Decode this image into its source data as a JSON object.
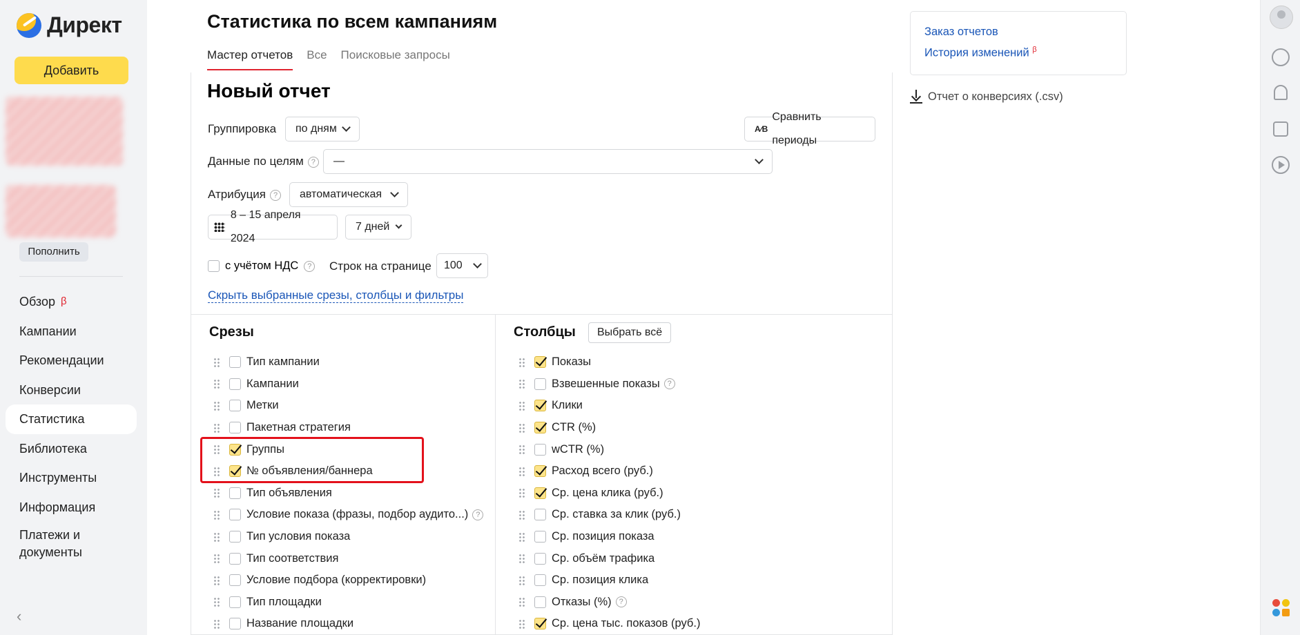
{
  "brand": {
    "name": "Директ"
  },
  "sidebar": {
    "add_label": "Добавить",
    "topup_label": "Пополнить",
    "nav": [
      {
        "label": "Обзор",
        "badge": "β"
      },
      {
        "label": "Кампании"
      },
      {
        "label": "Рекомендации"
      },
      {
        "label": "Конверсии"
      },
      {
        "label": "Статистика",
        "active": true
      },
      {
        "label": "Библиотека"
      },
      {
        "label": "Инструменты"
      },
      {
        "label": "Информация"
      },
      {
        "label": "Платежи и документы"
      }
    ],
    "collapse_glyph": "‹"
  },
  "header": {
    "title": "Статистика по всем кампаниям",
    "tabs": [
      {
        "label": "Мастер отчетов",
        "active": true
      },
      {
        "label": "Все"
      },
      {
        "label": "Поисковые запросы"
      }
    ]
  },
  "report": {
    "title": "Новый отчет",
    "grouping_label": "Группировка",
    "grouping_value": "по дням",
    "compare_label": "Сравнить периоды",
    "compare_glyph": "A⁄B",
    "goals_label": "Данные по целям",
    "goals_value": "—",
    "attribution_label": "Атрибуция",
    "attribution_value": "автоматическая",
    "date_range": "8 – 15 апреля 2024",
    "period_value": "7 дней",
    "vat_label": "с учётом НДС",
    "rows_label": "Строк на странице",
    "rows_value": "100",
    "hide_link": "Скрыть выбранные срезы, столбцы и фильтры",
    "help_glyph": "?"
  },
  "slices": {
    "title": "Срезы",
    "items": [
      {
        "label": "Тип кампании",
        "checked": false
      },
      {
        "label": "Кампании",
        "checked": false
      },
      {
        "label": "Метки",
        "checked": false
      },
      {
        "label": "Пакетная стратегия",
        "checked": false
      },
      {
        "label": "Группы",
        "checked": true
      },
      {
        "label": "№ объявления/баннера",
        "checked": true
      },
      {
        "label": "Тип объявления",
        "checked": false
      },
      {
        "label": "Условие показа (фразы, подбор аудито...)",
        "checked": false,
        "help": true
      },
      {
        "label": "Тип условия показа",
        "checked": false
      },
      {
        "label": "Тип соответствия",
        "checked": false
      },
      {
        "label": "Условие подбора (корректировки)",
        "checked": false
      },
      {
        "label": "Тип площадки",
        "checked": false
      },
      {
        "label": "Название площадки",
        "checked": false
      }
    ]
  },
  "columns": {
    "title": "Столбцы",
    "select_all_label": "Выбрать всё",
    "items": [
      {
        "label": "Показы",
        "checked": true
      },
      {
        "label": "Взвешенные показы",
        "checked": false,
        "help": true
      },
      {
        "label": "Клики",
        "checked": true
      },
      {
        "label": "CTR (%)",
        "checked": true
      },
      {
        "label": "wCTR (%)",
        "checked": false
      },
      {
        "label": "Расход всего (руб.)",
        "checked": true
      },
      {
        "label": "Ср. цена клика (руб.)",
        "checked": true
      },
      {
        "label": "Ср. ставка за клик (руб.)",
        "checked": false
      },
      {
        "label": "Ср. позиция показа",
        "checked": false
      },
      {
        "label": "Ср. объём трафика",
        "checked": false
      },
      {
        "label": "Ср. позиция клика",
        "checked": false
      },
      {
        "label": "Отказы (%)",
        "checked": false,
        "help": true
      },
      {
        "label": "Ср. цена тыс. показов (руб.)",
        "checked": true
      }
    ]
  },
  "right_panel": {
    "order_reports": "Заказ отчетов",
    "history": "История изменений",
    "history_badge": "β",
    "csv_link": "Отчет о конверсиях (.csv)"
  },
  "colors": {
    "accent_yellow": "#fedb4d",
    "link_blue": "#1a56b7",
    "highlight_red": "#e3111b"
  }
}
